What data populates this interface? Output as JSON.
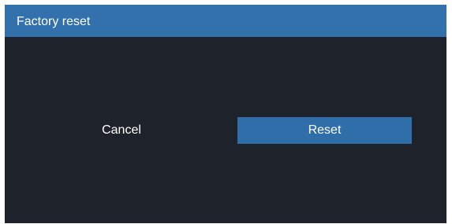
{
  "dialog": {
    "title": "Factory reset"
  },
  "buttons": {
    "cancel_label": "Cancel",
    "reset_label": "Reset"
  },
  "colors": {
    "titlebar": "#3271ab",
    "background": "#1e232b",
    "primary_button": "#2f6ea8",
    "text": "#ffffff"
  }
}
